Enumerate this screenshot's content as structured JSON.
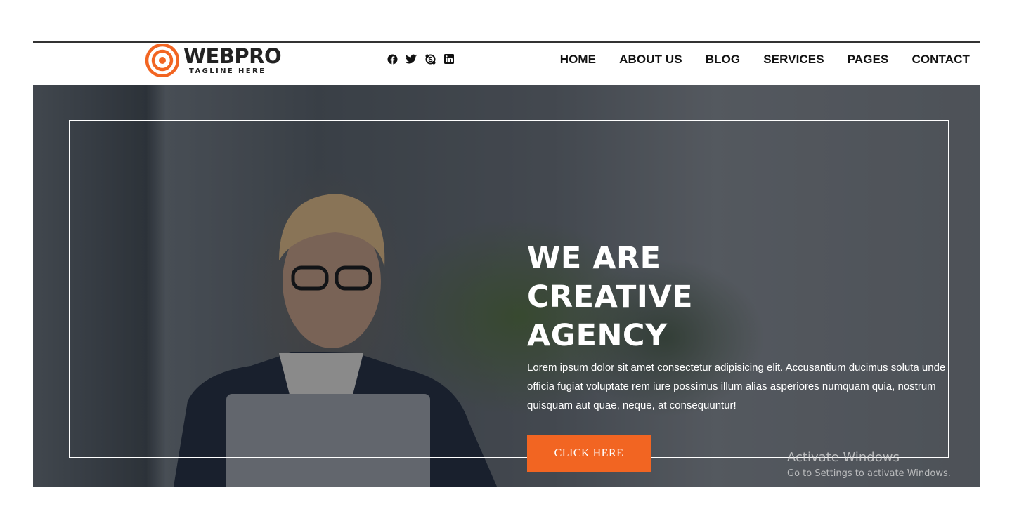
{
  "brand": {
    "name": "WEBPRO",
    "tagline": "TAGLINE HERE",
    "accent_color": "#f26522"
  },
  "social": [
    {
      "icon": "facebook-icon"
    },
    {
      "icon": "twitter-icon"
    },
    {
      "icon": "skype-icon"
    },
    {
      "icon": "linkedin-icon"
    }
  ],
  "nav": {
    "items": [
      "HOME",
      "ABOUT US",
      "BLOG",
      "SERVICES",
      "PAGES",
      "CONTACT"
    ]
  },
  "hero": {
    "title_line1": "WE ARE",
    "title_line2": "CREATIVE",
    "title_line3": "AGENCY",
    "text": "Lorem ipsum dolor sit amet consectetur adipisicing elit. Accusantium ducimus soluta unde officia fugiat voluptate rem iure possimus illum alias asperiores numquam quia, nostrum quisquam aut quae, neque, at consequuntur!",
    "button_label": "CLICK HERE"
  },
  "watermark": {
    "title": "Activate Windows",
    "subtitle": "Go to Settings to activate Windows."
  }
}
